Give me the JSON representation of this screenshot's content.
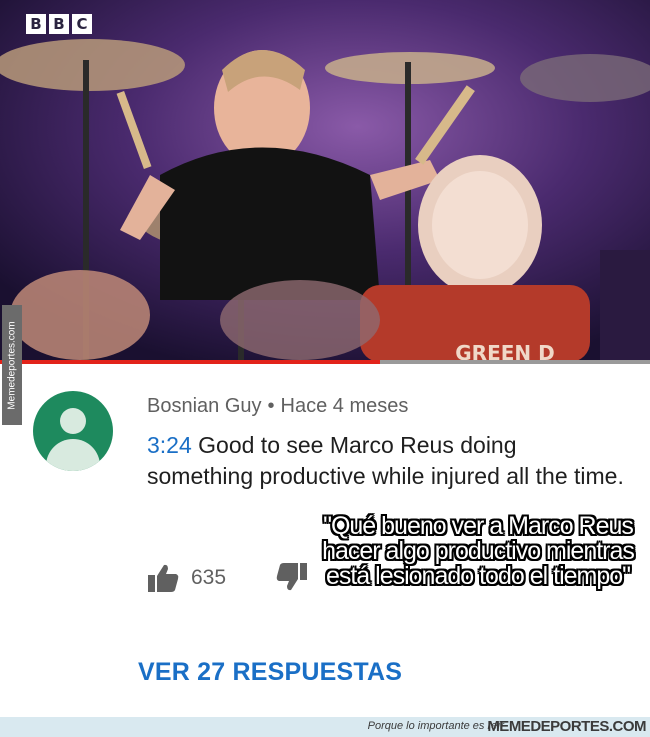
{
  "video": {
    "channel_logo_letters": [
      "B",
      "B",
      "C"
    ],
    "bass_drum_text": "GREEN D",
    "progress_fraction": 0.585,
    "progress_color": "#e2231a"
  },
  "watermark": {
    "side_text": "Memedeportes.com",
    "footer_tagline": "Porque lo importante es reír",
    "footer_brand": "MEMEDEPORTES.COM"
  },
  "comment": {
    "author": "Bosnian Guy",
    "separator": "•",
    "posted": "Hace 4 meses",
    "timestamp": "3:24",
    "text": " Good to see Marco Reus doing something productive while injured all the time.",
    "like_count": "635",
    "avatar_color": "#1e8a5e",
    "link_color": "#1a6fc6"
  },
  "overlay_caption": "\"Qué bueno ver a Marco Reus hacer algo productivo mientras está lesionado todo el tiempo\"",
  "replies": {
    "label": "VER 27 RESPUESTAS"
  }
}
